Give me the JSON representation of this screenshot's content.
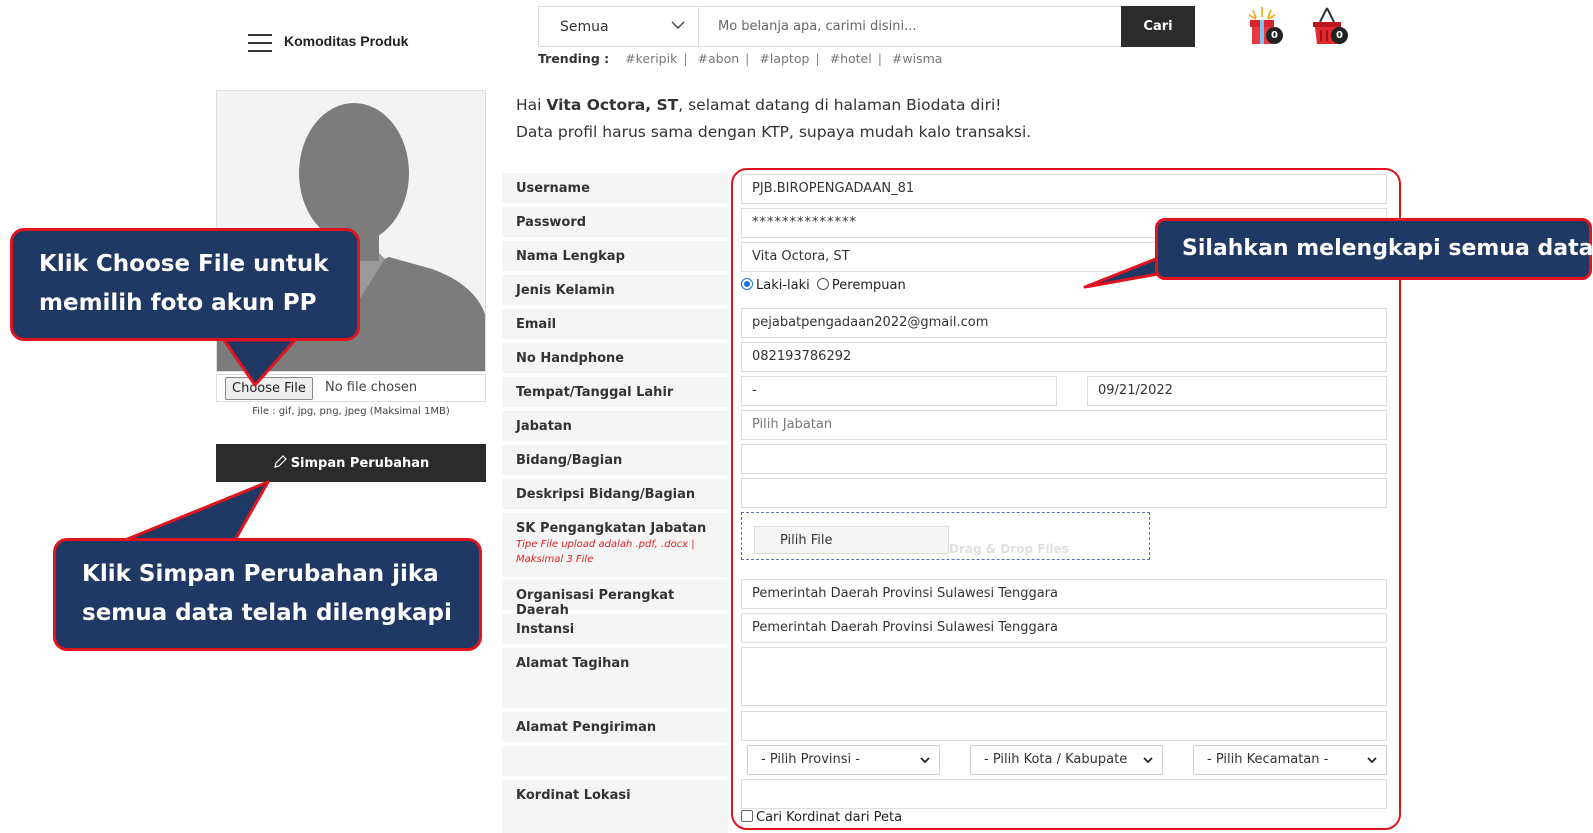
{
  "header": {
    "menu_label": "Komoditas Produk",
    "search_category": "Semua",
    "search_placeholder": "Mo belanja apa, carimi disini...",
    "search_button": "Cari",
    "trending_label": "Trending :",
    "trending_tags": [
      "#keripik",
      "#abon",
      "#laptop",
      "#hotel",
      "#wisma"
    ],
    "gift_count": "0",
    "cart_count": "0"
  },
  "profile": {
    "choose_file_button": "Choose File",
    "no_file_text": "No file chosen",
    "file_note": "File : gif, jpg, png, jpeg (Maksimal 1MB)",
    "save_button": "Simpan Perubahan"
  },
  "greeting": {
    "prefix": "Hai ",
    "name": "Vita Octora, ST",
    "suffix": ", selamat datang di halaman Biodata diri!",
    "line2": "Data profil harus sama dengan KTP, supaya mudah kalo transaksi."
  },
  "form": {
    "username_label": "Username",
    "username_value": "PJB.BIROPENGADAAN_81",
    "password_label": "Password",
    "password_value": "**************",
    "nama_label": "Nama Lengkap",
    "nama_value": "Vita Octora, ST",
    "gender_label": "Jenis Kelamin",
    "gender_male": "Laki-laki",
    "gender_female": "Perempuan",
    "email_label": "Email",
    "email_value": "pejabatpengadaan2022@gmail.com",
    "hp_label": "No Handphone",
    "hp_value": "082193786292",
    "ttl_label": "Tempat/Tanggal Lahir",
    "tempat_value": "-",
    "tanggal_value": "09/21/2022",
    "jabatan_label": "Jabatan",
    "jabatan_placeholder": "Pilih Jabatan",
    "bidang_label": "Bidang/Bagian",
    "deskripsi_label": "Deskripsi Bidang/Bagian",
    "sk_label": "SK Pengangkatan Jabatan",
    "sk_note": "Tipe File upload adalah .pdf, .docx | Maksimal 3 File",
    "pilih_file_button": "Pilih File",
    "drag_drop_text": "Drag & Drop Files",
    "opd_label": "Organisasi Perangkat Daerah",
    "opd_value": "Pemerintah Daerah Provinsi Sulawesi Tenggara",
    "instansi_label": "Instansi",
    "instansi_value": "Pemerintah Daerah Provinsi Sulawesi Tenggara",
    "alamat_tagihan_label": "Alamat Tagihan",
    "alamat_pengiriman_label": "Alamat Pengiriman",
    "provinsi_select": "- Pilih Provinsi -",
    "kota_select": "- Pilih Kota / Kabupate",
    "kecamatan_select": "- Pilih Kecamatan -",
    "kordinat_label": "Kordinat Lokasi",
    "cari_kordinat": "Cari Kordinat dari Peta"
  },
  "callouts": {
    "choose_file": [
      "Klik Choose File untuk",
      "memilih foto akun PP"
    ],
    "simpan": [
      "Klik Simpan Perubahan jika",
      "semua data telah dilengkapi"
    ],
    "lengkapi": "Silahkan melengkapi semua data"
  },
  "colors": {
    "callout_bg": "#1f3864",
    "callout_border": "#e0141e",
    "dark_button": "#2b2b2b"
  }
}
